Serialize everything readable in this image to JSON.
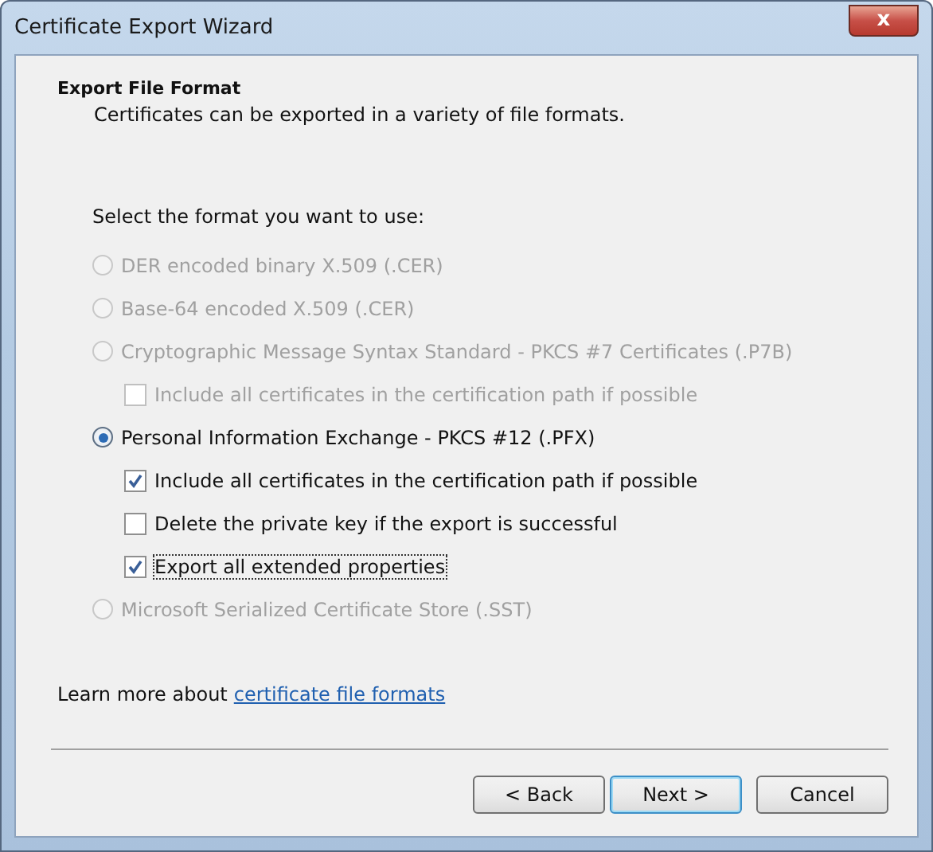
{
  "window": {
    "title": "Certificate Export Wizard",
    "close": "x"
  },
  "header": {
    "title": "Export File Format",
    "subtitle": "Certificates can be exported in a variety of file formats."
  },
  "prompt": "Select the format you want to use:",
  "formats": [
    {
      "label": "DER encoded binary X.509 (.CER)",
      "selected": false,
      "disabled": true
    },
    {
      "label": "Base-64 encoded X.509 (.CER)",
      "selected": false,
      "disabled": true
    },
    {
      "label": "Cryptographic Message Syntax Standard - PKCS #7 Certificates (.P7B)",
      "selected": false,
      "disabled": true,
      "options": [
        {
          "label": "Include all certificates in the certification path if possible",
          "checked": false,
          "disabled": true,
          "focused": false
        }
      ]
    },
    {
      "label": "Personal Information Exchange - PKCS #12 (.PFX)",
      "selected": true,
      "disabled": false,
      "options": [
        {
          "label": "Include all certificates in the certification path if possible",
          "checked": true,
          "disabled": false,
          "focused": false
        },
        {
          "label": "Delete the private key if the export is successful",
          "checked": false,
          "disabled": false,
          "focused": false
        },
        {
          "label": "Export all extended properties",
          "checked": true,
          "disabled": false,
          "focused": true
        }
      ]
    },
    {
      "label": "Microsoft Serialized Certificate Store (.SST)",
      "selected": false,
      "disabled": true
    }
  ],
  "learn_more": {
    "text": "Learn more about",
    "link": "certificate file formats"
  },
  "buttons": [
    {
      "label": "< Back",
      "default": false
    },
    {
      "label": "Next >",
      "default": true
    },
    {
      "label": "Cancel",
      "default": false
    }
  ]
}
